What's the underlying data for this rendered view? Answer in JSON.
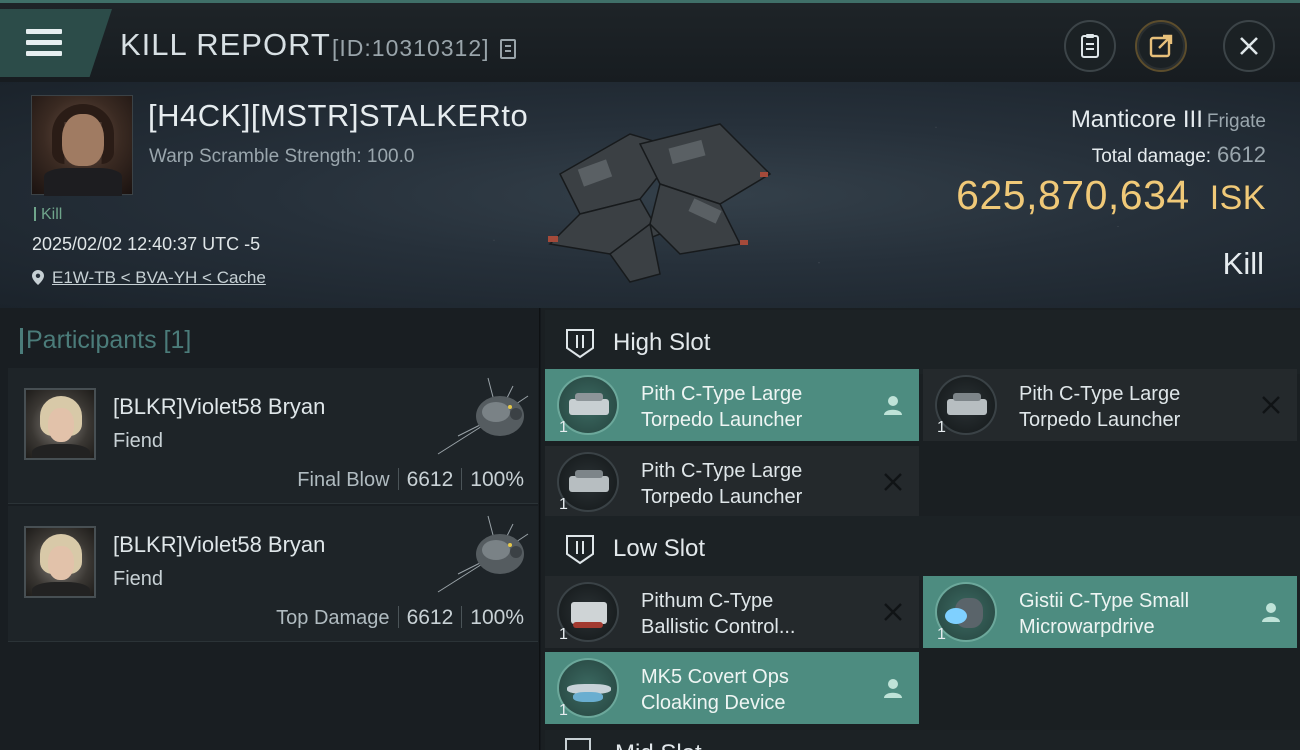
{
  "titlebar": {
    "title": "KILL REPORT",
    "report_id": "[ID:10310312]"
  },
  "victim": {
    "name": "[H4CK][MSTR]STALKERto",
    "subtitle": "Warp Scramble Strength: 100.0",
    "tag": "Kill",
    "datetime": "2025/02/02 12:40:37 UTC -5",
    "location": "E1W-TB < BVA-YH < Cache",
    "ship_name": "Manticore III",
    "ship_class": "Frigate",
    "total_damage_label": "Total damage:",
    "total_damage": "6612",
    "isk_value": "625,870,634",
    "isk_unit": "ISK",
    "result": "Kill"
  },
  "participants": {
    "title": "Participants [1]",
    "rows": [
      {
        "name": "[BLKR]Violet58 Bryan",
        "ship": "Fiend",
        "role": "Final Blow",
        "damage": "6612",
        "percent": "100%"
      },
      {
        "name": "[BLKR]Violet58 Bryan",
        "ship": "Fiend",
        "role": "Top Damage",
        "damage": "6612",
        "percent": "100%"
      }
    ]
  },
  "fitting": {
    "high_slot": {
      "title": "High Slot",
      "modules": [
        {
          "line1": "Pith C-Type Large",
          "line2": "Torpedo Launcher",
          "qty": "1",
          "status": "dropped"
        },
        {
          "line1": "Pith C-Type Large",
          "line2": "Torpedo Launcher",
          "qty": "1",
          "status": "destroyed"
        },
        {
          "line1": "Pith C-Type Large",
          "line2": "Torpedo Launcher",
          "qty": "1",
          "status": "destroyed"
        }
      ]
    },
    "low_slot": {
      "title": "Low Slot",
      "modules": [
        {
          "line1": "Pithum C-Type",
          "line2": "Ballistic Control...",
          "qty": "1",
          "status": "destroyed"
        },
        {
          "line1": "Gistii C-Type Small",
          "line2": "Microwarpdrive",
          "qty": "1",
          "status": "dropped"
        },
        {
          "line1": "MK5 Covert Ops",
          "line2": "Cloaking Device",
          "qty": "1",
          "status": "dropped"
        }
      ]
    },
    "next_slot_partial": "Mid Slot"
  },
  "colors": {
    "accent_teal": "#4d8c80",
    "isk_gold": "#f0c978",
    "participants_title": "#4b7c7a"
  },
  "icons": {
    "menu": "hamburger-icon",
    "copy": "copy-icon",
    "clipboard": "clipboard-icon",
    "share": "share-icon",
    "close": "close-icon",
    "location": "map-pin-icon",
    "dropped": "person-icon",
    "destroyed": "x-icon"
  }
}
